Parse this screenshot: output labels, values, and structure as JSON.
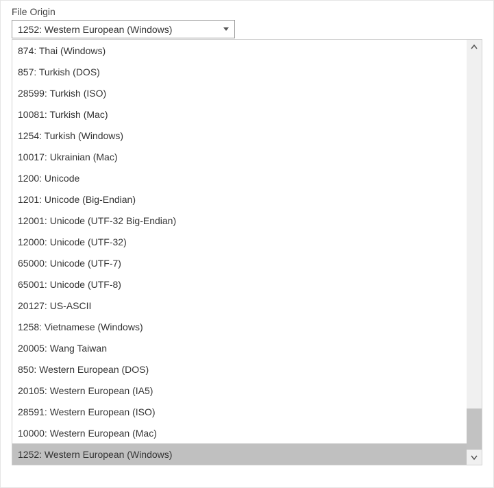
{
  "label": "File Origin",
  "selected": "1252: Western European (Windows)",
  "options": [
    "874: Thai (Windows)",
    "857: Turkish (DOS)",
    "28599: Turkish (ISO)",
    "10081: Turkish (Mac)",
    "1254: Turkish (Windows)",
    "10017: Ukrainian (Mac)",
    "1200: Unicode",
    "1201: Unicode (Big-Endian)",
    "12001: Unicode (UTF-32 Big-Endian)",
    "12000: Unicode (UTF-32)",
    "65000: Unicode (UTF-7)",
    "65001: Unicode (UTF-8)",
    "20127: US-ASCII",
    "1258: Vietnamese (Windows)",
    "20005: Wang Taiwan",
    "850: Western European (DOS)",
    "20105: Western European (IA5)",
    "28591: Western European (ISO)",
    "10000: Western European (Mac)",
    "1252: Western European (Windows)"
  ],
  "selectedIndex": 19
}
